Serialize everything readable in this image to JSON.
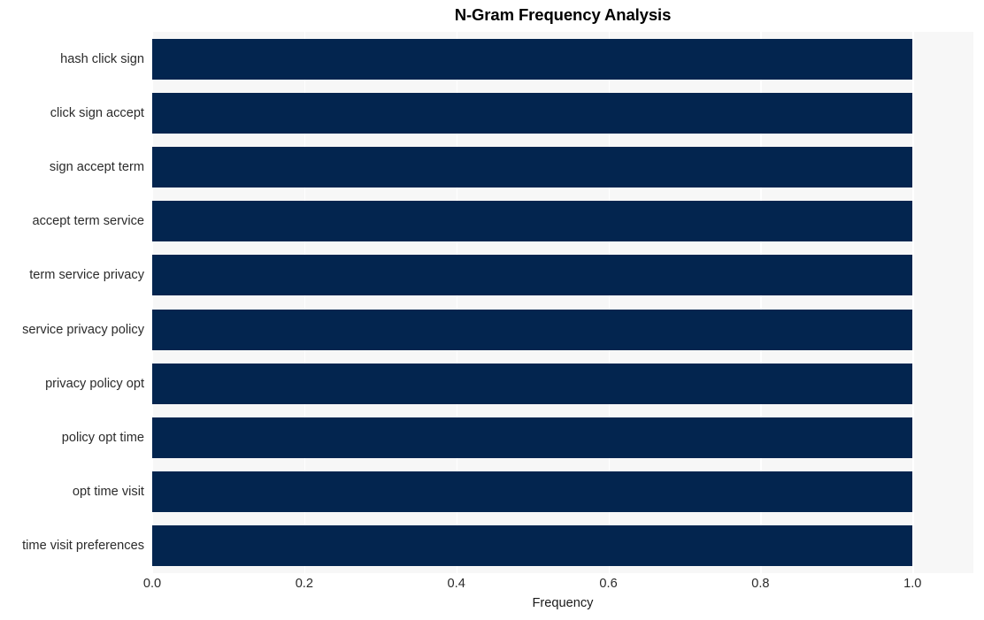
{
  "chart_data": {
    "type": "bar",
    "orientation": "horizontal",
    "title": "N-Gram Frequency Analysis",
    "xlabel": "Frequency",
    "ylabel": "",
    "categories": [
      "hash click sign",
      "click sign accept",
      "sign accept term",
      "accept term service",
      "term service privacy",
      "service privacy policy",
      "privacy policy opt",
      "policy opt time",
      "opt time visit",
      "time visit preferences"
    ],
    "values": [
      1.0,
      1.0,
      1.0,
      1.0,
      1.0,
      1.0,
      1.0,
      1.0,
      1.0,
      1.0
    ],
    "xlim": [
      0.0,
      1.08
    ],
    "xticks": [
      0.0,
      0.2,
      0.4,
      0.6,
      0.8,
      1.0
    ],
    "xtick_labels": [
      "0.0",
      "0.2",
      "0.4",
      "0.6",
      "0.8",
      "1.0"
    ],
    "grid": true,
    "grid_axis": "x",
    "legend": false,
    "bar_color": "#03254f",
    "plot_background": "#f7f7f7",
    "grid_color": "#ffffff",
    "figure_background": "#ffffff",
    "title_color": "#000000",
    "tick_label_color": "#2b2b2b"
  }
}
